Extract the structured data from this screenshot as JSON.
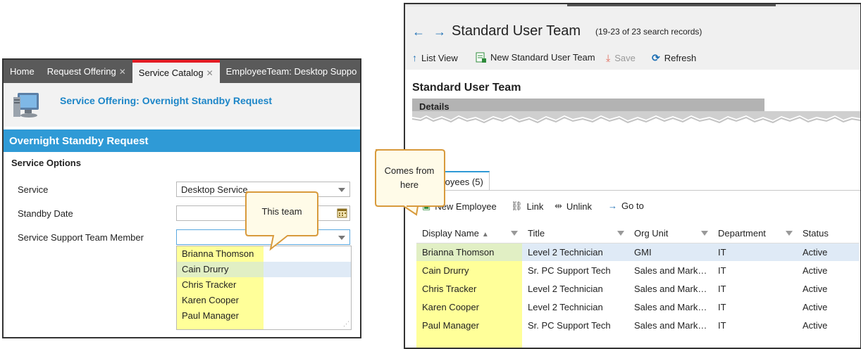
{
  "left": {
    "tabs": [
      {
        "label": "Home",
        "closable": false,
        "active": false
      },
      {
        "label": "Request Offering",
        "closable": true,
        "active": false
      },
      {
        "label": "Service Catalog",
        "closable": true,
        "active": true
      },
      {
        "label": "EmployeeTeam: Desktop Suppo",
        "closable": false,
        "active": false
      }
    ],
    "offering_title": "Service Offering: Overnight Standby Request",
    "form_title": "Overnight Standby Request",
    "section_label": "Service Options",
    "fields": {
      "service_label": "Service",
      "service_value": "Desktop Service",
      "standby_label": "Standby Date",
      "member_label": "Service Support Team Member"
    },
    "dropdown_items": [
      "Brianna Thomson",
      "Cain Drurry",
      "Chris Tracker",
      "Karen Cooper",
      "Paul Manager"
    ],
    "callout": "This team",
    "close_glyph": "✕"
  },
  "right": {
    "title": "Standard User Team",
    "record_count": "(19-23 of 23 search records)",
    "toolbar": {
      "list_view": "List View",
      "new_team": "New Standard User Team",
      "save": "Save",
      "refresh": "Refresh"
    },
    "section_title": "Standard User Team",
    "details_label": "Details",
    "employees_tab": "Employees (5)",
    "subtoolbar": {
      "new_employee": "New Employee",
      "link": "Link",
      "unlink": "Unlink",
      "go_to": "Go to"
    },
    "columns": [
      "Display Name",
      "Title",
      "Org Unit",
      "Department",
      "Status"
    ],
    "rows": [
      [
        "Brianna Thomson",
        "Level 2 Technician",
        "GMI",
        "IT",
        "Active"
      ],
      [
        "Cain Drurry",
        "Sr. PC Support Tech",
        "Sales and Mark…",
        "IT",
        "Active"
      ],
      [
        "Chris Tracker",
        "Level 2 Technician",
        "Sales and Mark…",
        "IT",
        "Active"
      ],
      [
        "Karen Cooper",
        "Level 2 Technician",
        "Sales and Mark…",
        "IT",
        "Active"
      ],
      [
        "Paul Manager",
        "Sr. PC Support Tech",
        "Sales and Mark…",
        "IT",
        "Active"
      ]
    ],
    "callout": "Comes from here"
  },
  "colors": {
    "accent_blue": "#2f9ad6",
    "active_tab_red": "#e31b23",
    "highlight_yellow": "#ffff99",
    "callout_border": "#d89a3c"
  }
}
